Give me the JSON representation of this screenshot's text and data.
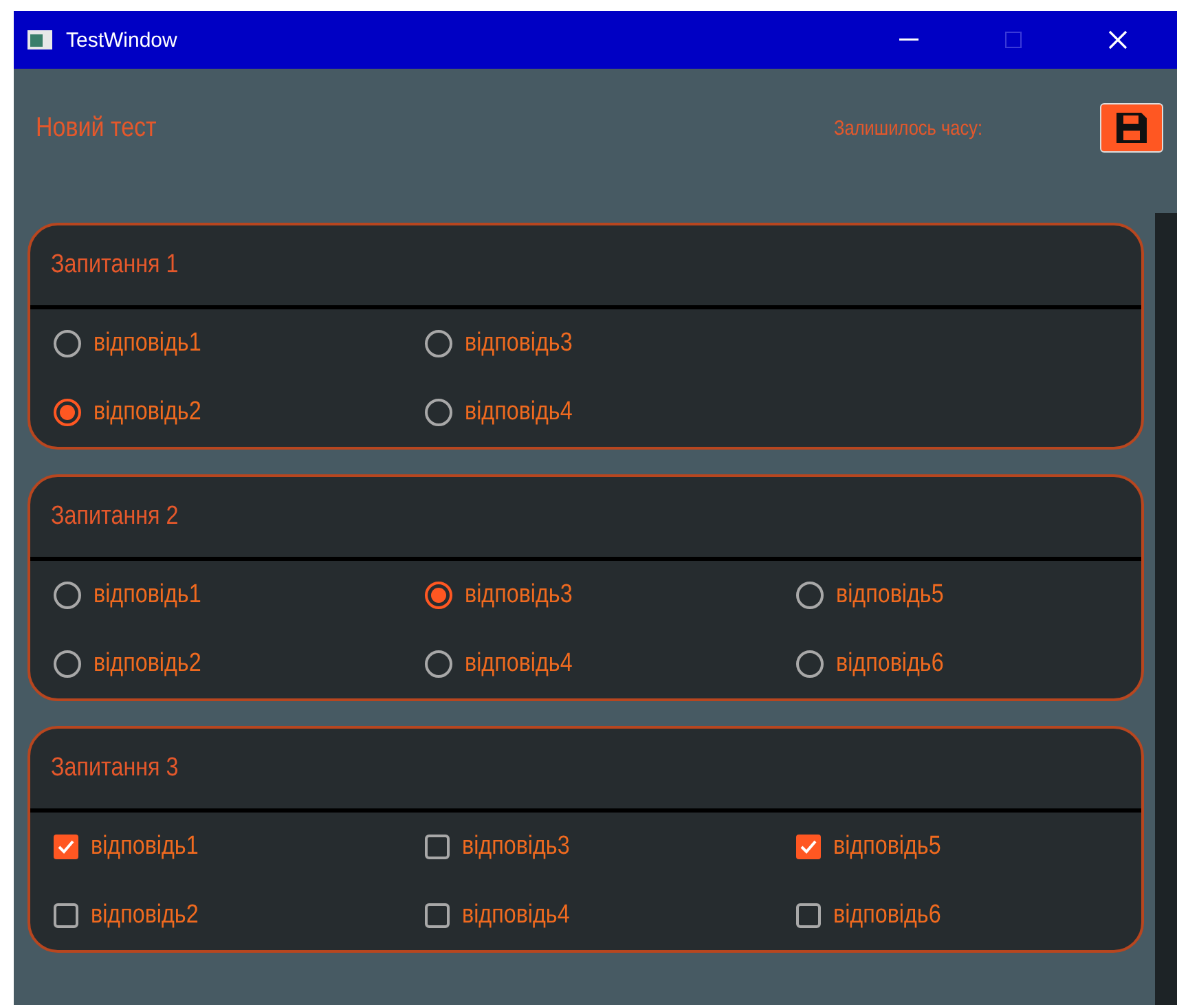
{
  "window": {
    "title": "TestWindow"
  },
  "header": {
    "title": "Новий тест",
    "time_label": "Залишилось часу:"
  },
  "questions": [
    {
      "title": "Запитання 1",
      "kind": "radio",
      "options": [
        {
          "label": "відповідь1",
          "selected": false
        },
        {
          "label": "відповідь2",
          "selected": true
        },
        {
          "label": "відповідь3",
          "selected": false
        },
        {
          "label": "відповідь4",
          "selected": false
        }
      ]
    },
    {
      "title": "Запитання 2",
      "kind": "radio",
      "options": [
        {
          "label": "відповідь1",
          "selected": false
        },
        {
          "label": "відповідь2",
          "selected": false
        },
        {
          "label": "відповідь3",
          "selected": true
        },
        {
          "label": "відповідь4",
          "selected": false
        },
        {
          "label": "відповідь5",
          "selected": false
        },
        {
          "label": "відповідь6",
          "selected": false
        }
      ]
    },
    {
      "title": "Запитання 3",
      "kind": "checkbox",
      "options": [
        {
          "label": "відповідь1",
          "selected": true
        },
        {
          "label": "відповідь2",
          "selected": false
        },
        {
          "label": "відповідь3",
          "selected": false
        },
        {
          "label": "відповідь4",
          "selected": false
        },
        {
          "label": "відповідь5",
          "selected": true
        },
        {
          "label": "відповідь6",
          "selected": false
        }
      ]
    }
  ]
}
